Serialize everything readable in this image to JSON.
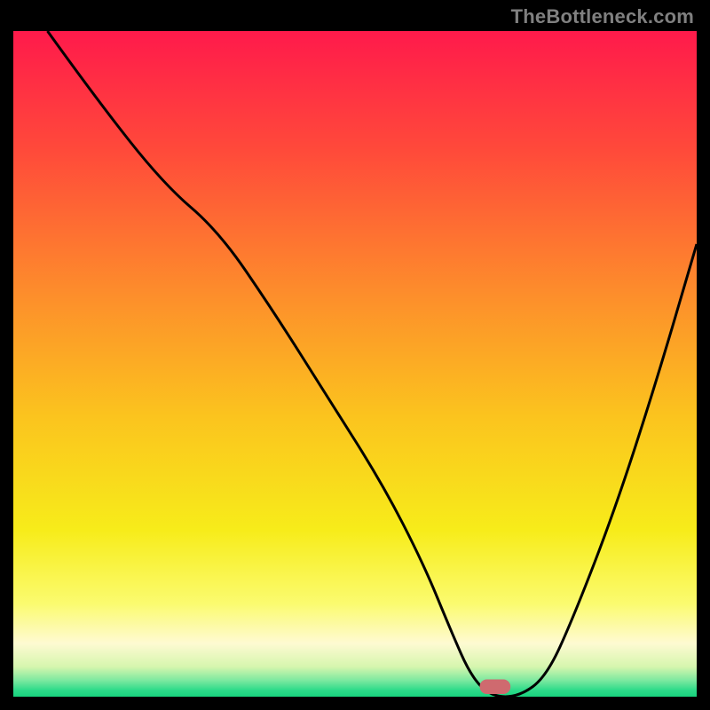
{
  "watermark": "TheBottleneck.com",
  "chart_data": {
    "type": "line",
    "title": "",
    "xlabel": "",
    "ylabel": "",
    "xlim": [
      0,
      100
    ],
    "ylim": [
      0,
      100
    ],
    "grid": false,
    "legend": false,
    "gradient_stops": [
      {
        "offset": 0.0,
        "color": "#ff1a4b"
      },
      {
        "offset": 0.18,
        "color": "#ff4a3a"
      },
      {
        "offset": 0.4,
        "color": "#fd8f2b"
      },
      {
        "offset": 0.58,
        "color": "#fbc41e"
      },
      {
        "offset": 0.75,
        "color": "#f7ec1a"
      },
      {
        "offset": 0.86,
        "color": "#fbfb6f"
      },
      {
        "offset": 0.92,
        "color": "#fefad2"
      },
      {
        "offset": 0.955,
        "color": "#d6f6ae"
      },
      {
        "offset": 0.975,
        "color": "#7fe9a0"
      },
      {
        "offset": 0.99,
        "color": "#2edb8a"
      },
      {
        "offset": 1.0,
        "color": "#18d37e"
      }
    ],
    "series": [
      {
        "name": "bottleneck-curve",
        "x": [
          5,
          12,
          22,
          30,
          38,
          46,
          54,
          60,
          64,
          67,
          70,
          74,
          78,
          82,
          88,
          94,
          100
        ],
        "y": [
          100,
          90,
          77,
          70,
          58,
          45,
          32,
          20,
          10,
          3,
          0,
          0,
          3,
          12,
          28,
          47,
          68
        ]
      }
    ],
    "marker": {
      "name": "optimal-point",
      "x": 70.5,
      "y": 1.5,
      "color": "#cf6a6f",
      "width_frac": 0.045,
      "height_frac": 0.022
    }
  }
}
